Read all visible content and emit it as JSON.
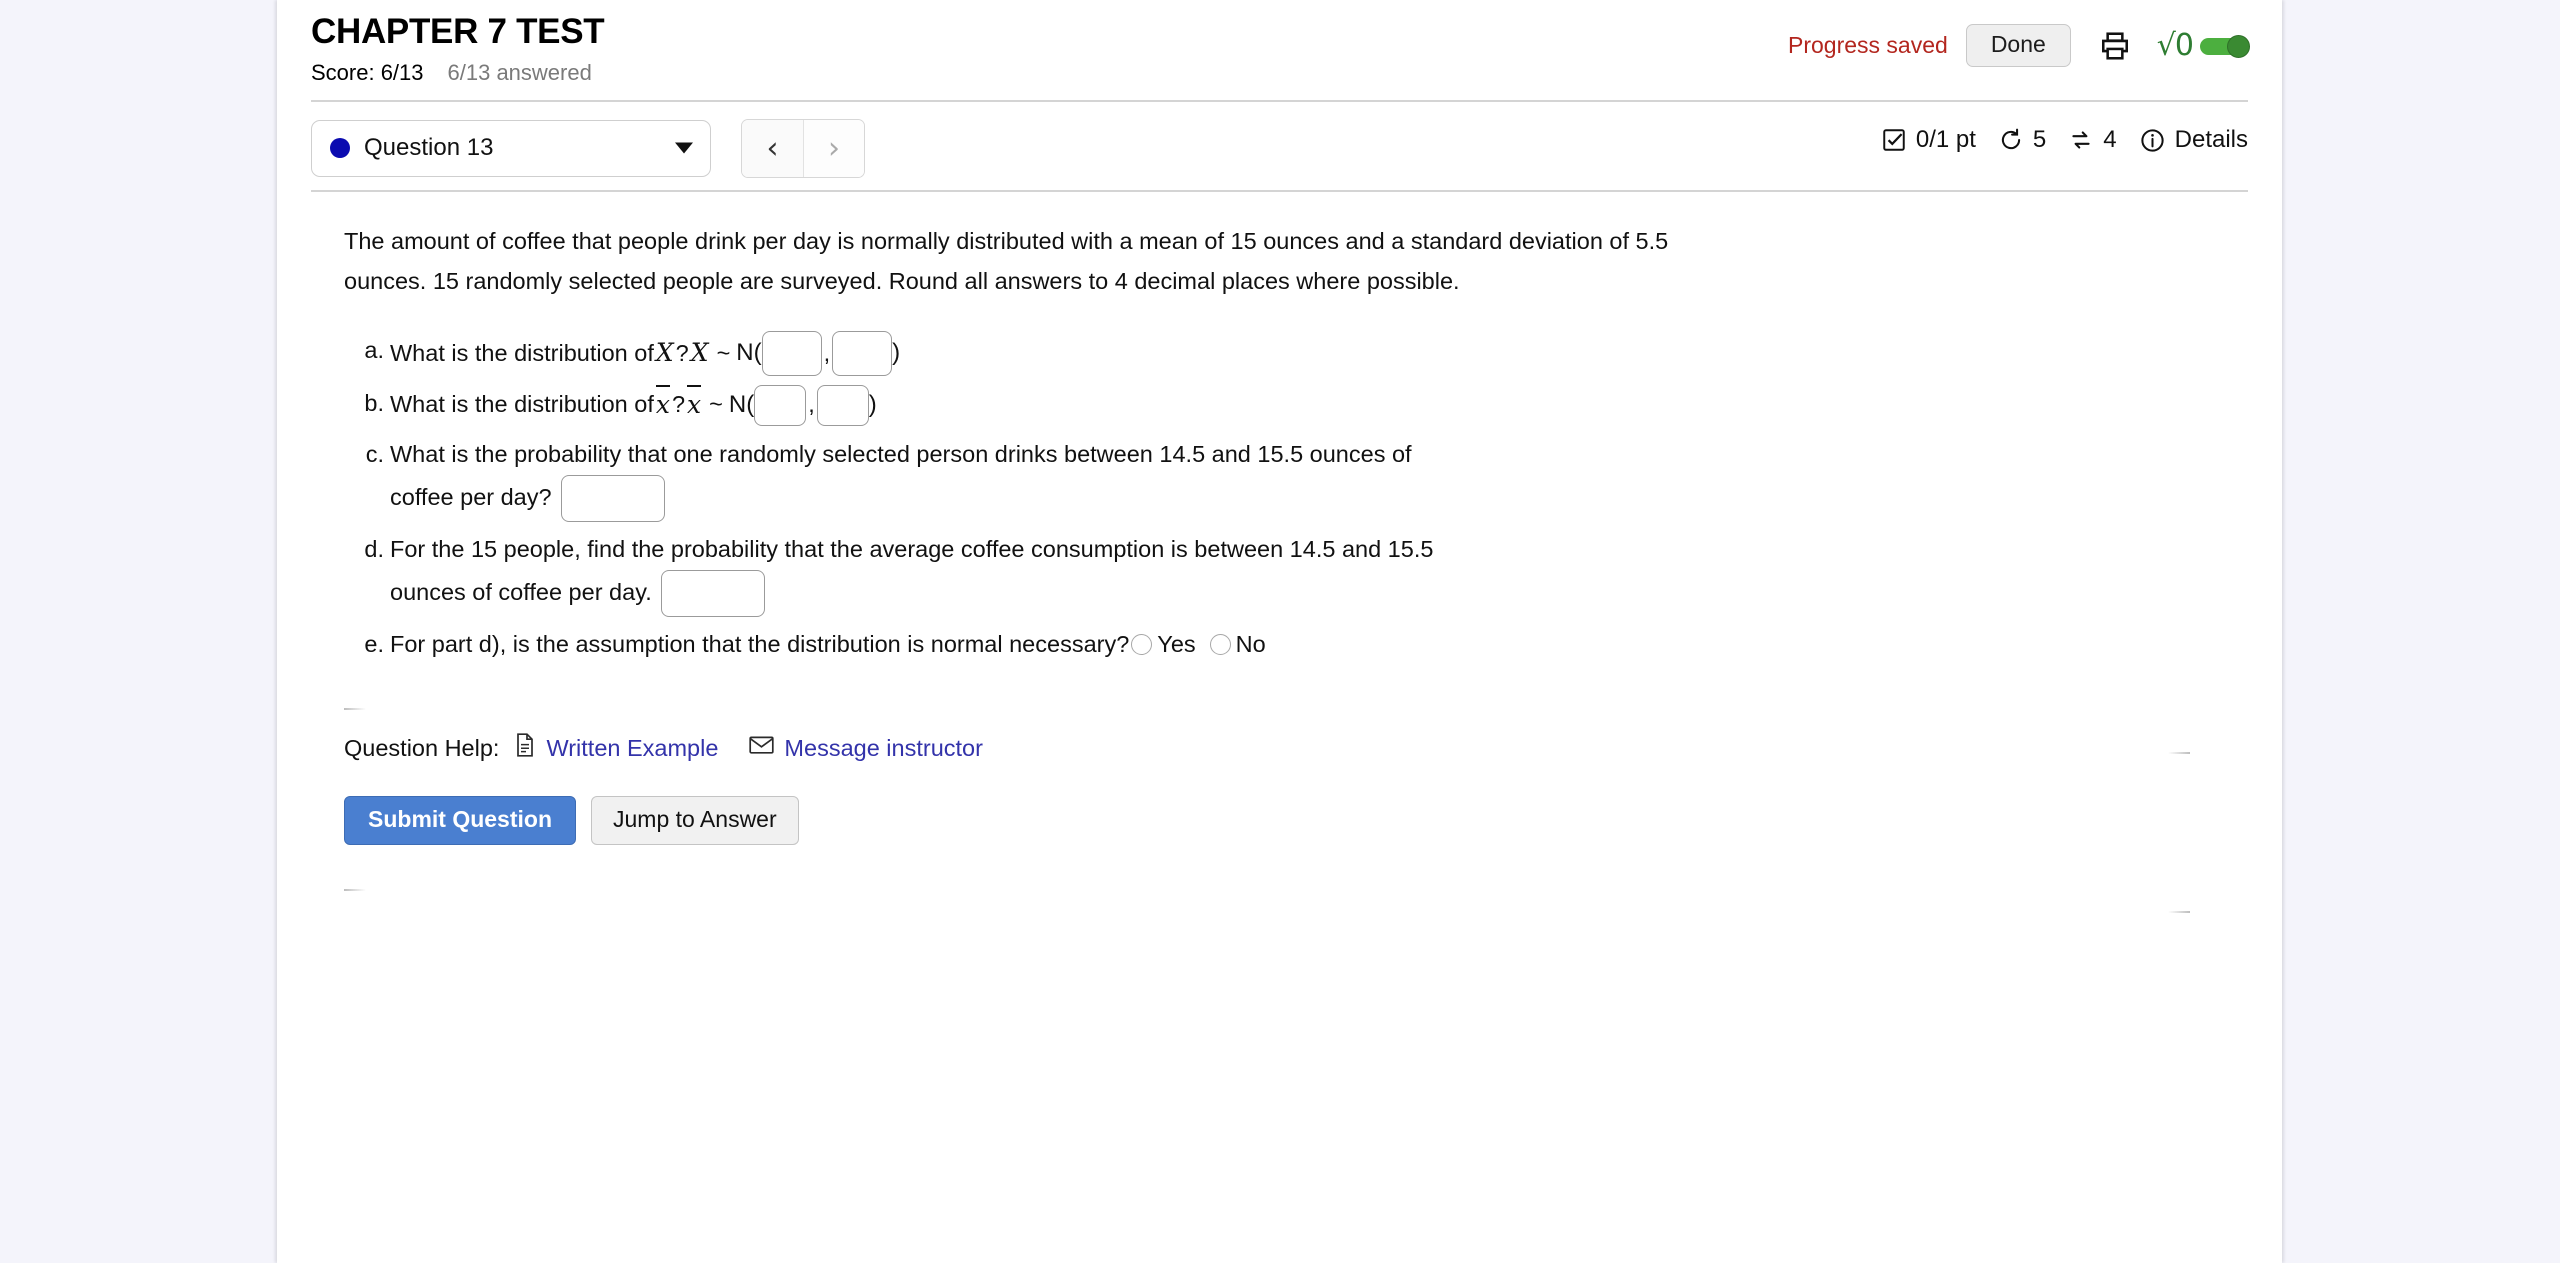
{
  "header": {
    "title": "CHAPTER 7 TEST",
    "score_label": "Score: 6/13",
    "answered_label": "6/13 answered",
    "progress_saved": "Progress saved",
    "done_label": "Done",
    "print_icon": "printer-icon",
    "calculator_radical": "√0",
    "calculator_toggle_state": "on",
    "progress_saved_color": "#b3261e",
    "calculator_color": "#2e7d32"
  },
  "nav": {
    "question_label": "Question 13",
    "status_dot_color": "#0b0bb0",
    "prev_label": "‹",
    "next_label": "›",
    "points": "0/1 pt",
    "attempts": "5",
    "versions": "4",
    "details_label": "Details"
  },
  "question": {
    "intro": "The amount of coffee that people drink per day is normally distributed with a mean of 15 ounces and a standard deviation of 5.5 ounces. 15 randomly selected people are surveyed. Round all answers to 4 decimal places where possible.",
    "parts": {
      "a": {
        "text_before": "What is the distribution of",
        "var1": "X",
        "q_mark": "?",
        "var2": "X",
        "tilde": "~",
        "dist": "N(",
        "input1": "",
        "comma": ",",
        "input2": "",
        "close": ")"
      },
      "b": {
        "text_before": "What is the distribution of",
        "var1": "x",
        "q_mark": "?",
        "var2": "x",
        "tilde": "~",
        "dist": "N(",
        "input1": "",
        "comma": ",",
        "input2": "",
        "close": ")"
      },
      "c": {
        "line1": "What is the probability that one randomly selected person drinks between 14.5 and 15.5 ounces of",
        "line2": "coffee per day?",
        "input": ""
      },
      "d": {
        "line1": "For the 15 people, find the probability that the average coffee consumption is between 14.5 and 15.5",
        "line2": "ounces of coffee per day.",
        "input": ""
      },
      "e": {
        "text": "For part d), is the assumption that the distribution is normal necessary?",
        "option_yes": "Yes",
        "option_no": "No",
        "selected": ""
      }
    }
  },
  "help": {
    "label": "Question Help:",
    "written_example": "Written Example",
    "message_instructor": "Message instructor",
    "link_color": "#3333aa"
  },
  "footer": {
    "submit_label": "Submit Question",
    "jump_label": "Jump to Answer",
    "submit_color": "#4a7fd0"
  }
}
